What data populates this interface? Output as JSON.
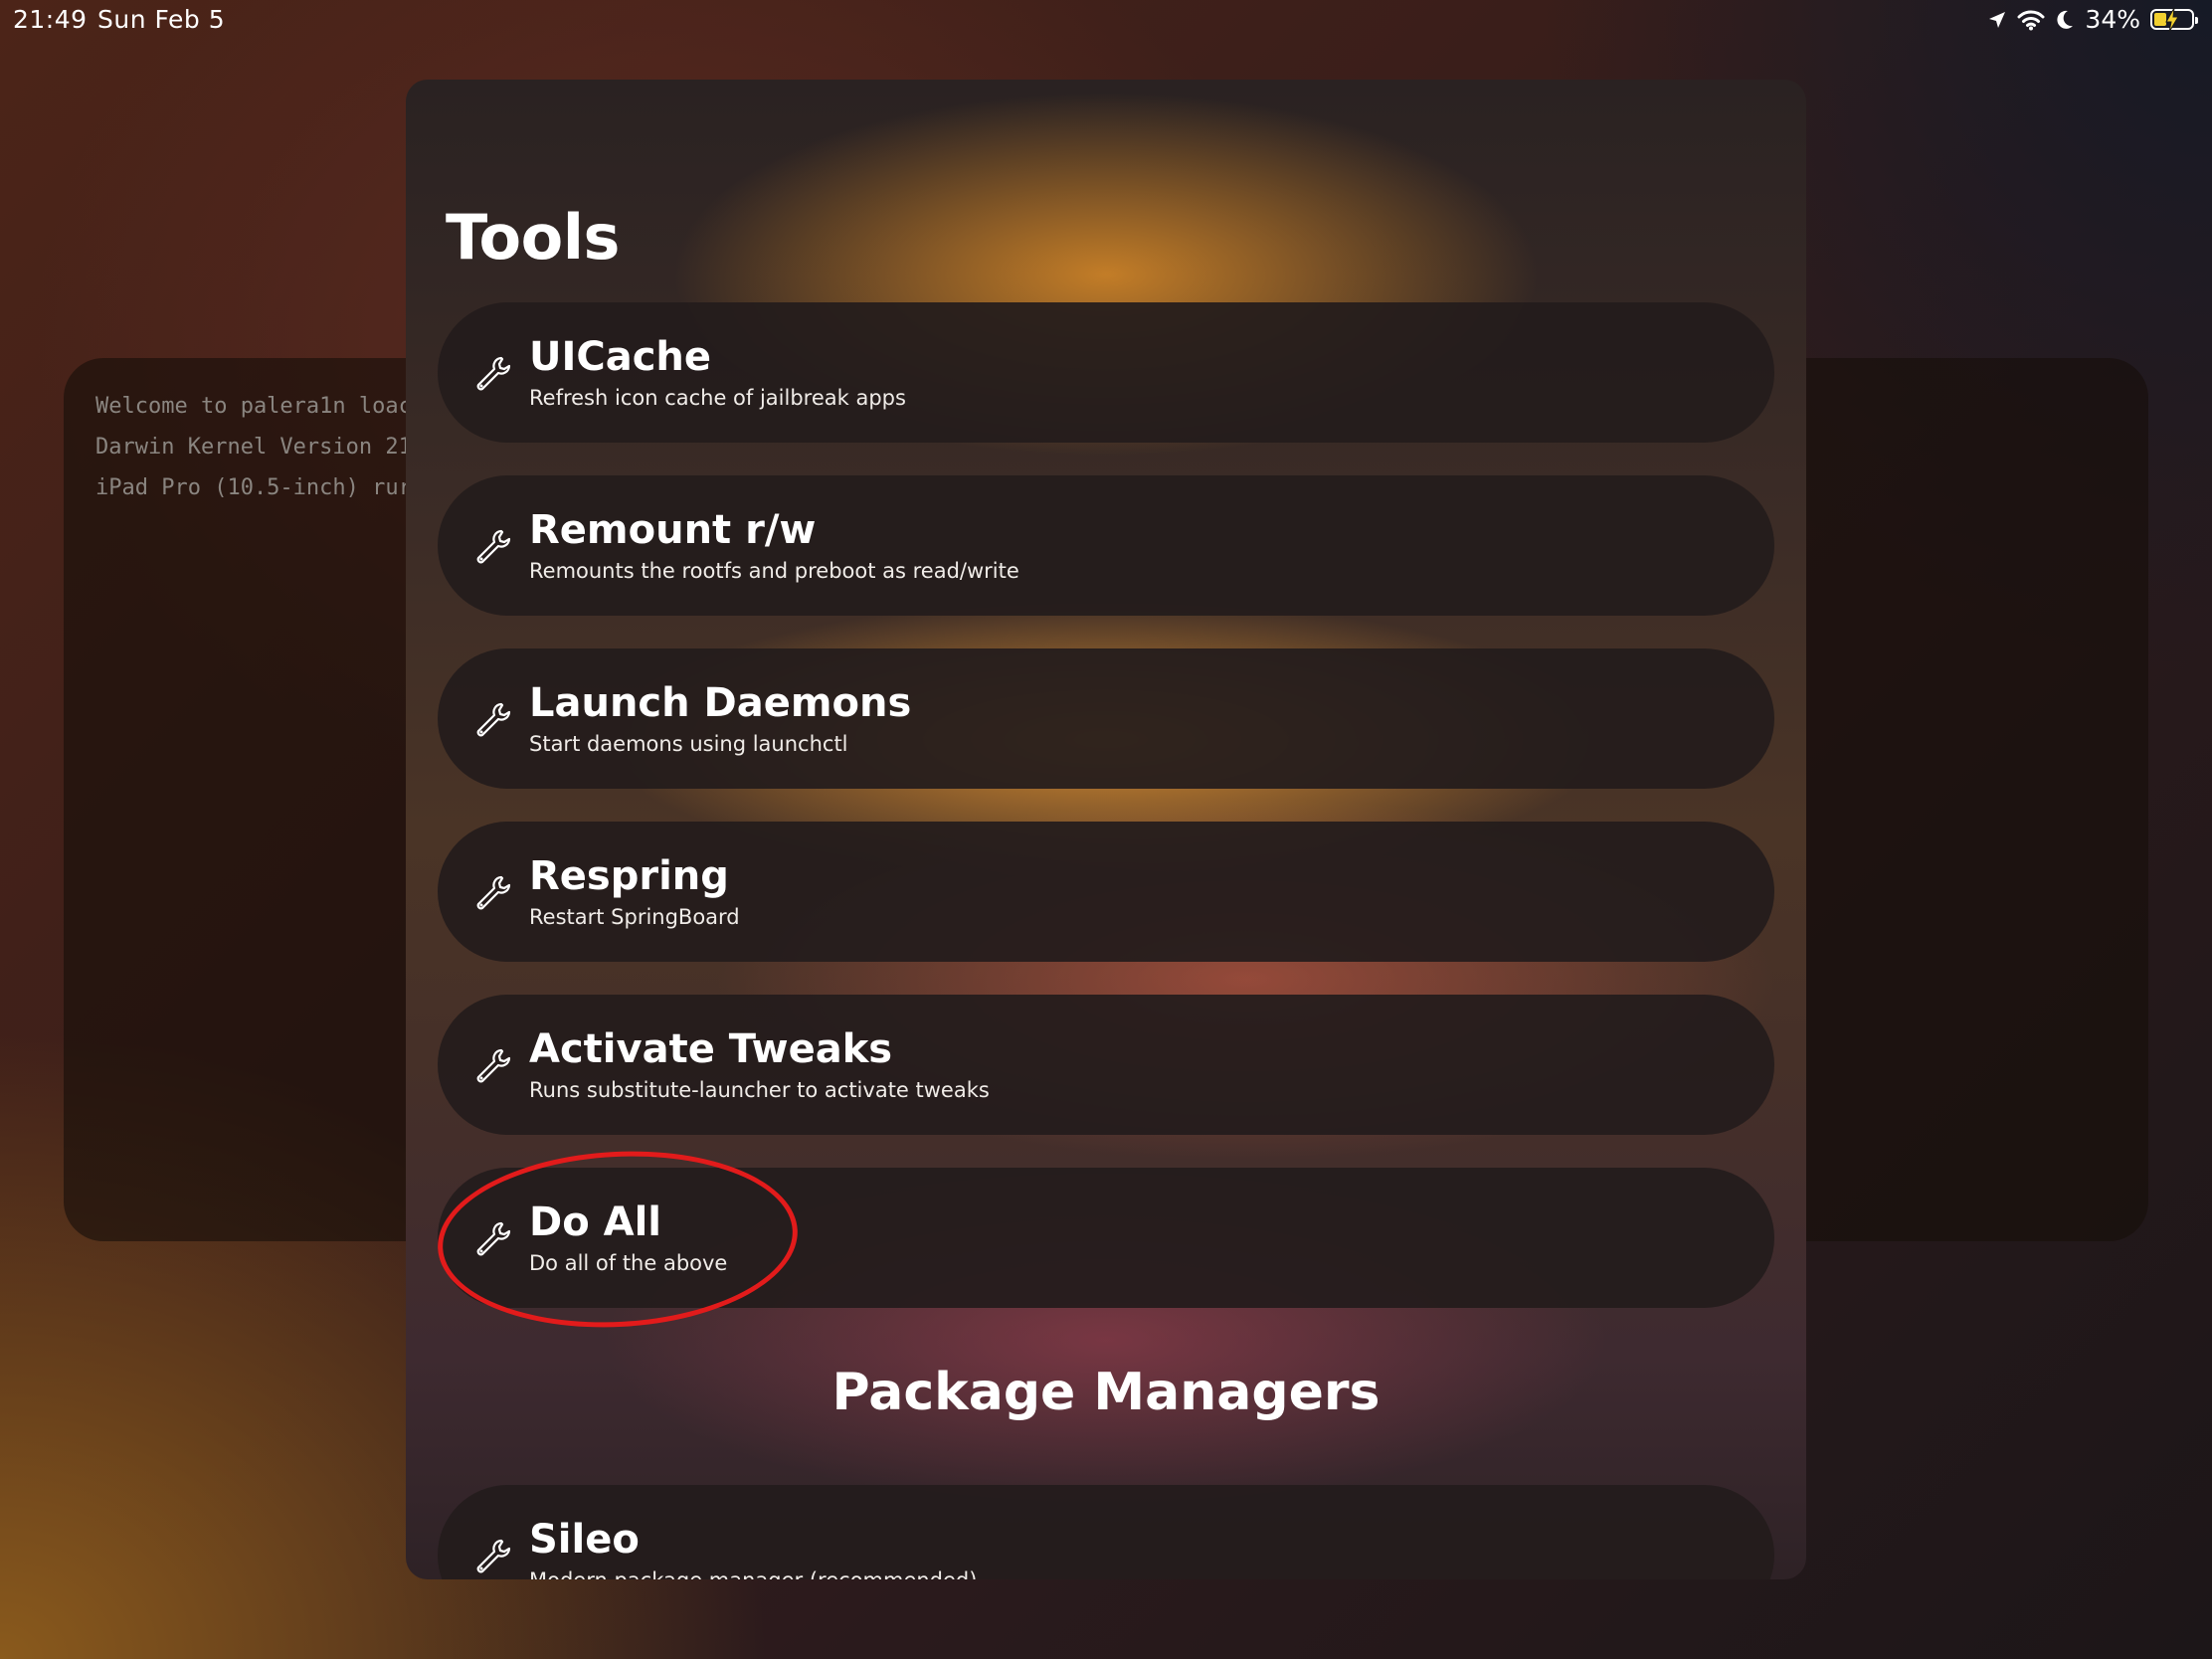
{
  "status_bar": {
    "time": "21:49",
    "date": "Sun Feb 5",
    "battery": "34%",
    "battery_level": 0.34,
    "icons": [
      "location-arrow-icon",
      "wifi-icon",
      "moon-icon",
      "battery-charging-icon"
    ]
  },
  "terminal": {
    "lines": [
      "Welcome to palera1n loac",
      "Darwin Kernel Version 21",
      "iPad Pro (10.5-inch) rur"
    ]
  },
  "tools": {
    "title": "Tools",
    "items": [
      {
        "title": "UICache",
        "description": "Refresh icon cache of jailbreak apps",
        "icon": "wrench-icon"
      },
      {
        "title": "Remount r/w",
        "description": "Remounts the rootfs and preboot as read/write",
        "icon": "wrench-icon"
      },
      {
        "title": "Launch Daemons",
        "description": "Start daemons using launchctl",
        "icon": "wrench-icon"
      },
      {
        "title": "Respring",
        "description": "Restart SpringBoard",
        "icon": "wrench-icon"
      },
      {
        "title": "Activate Tweaks",
        "description": "Runs substitute-launcher to activate tweaks",
        "icon": "wrench-icon"
      },
      {
        "title": "Do All",
        "description": "Do all of the above",
        "icon": "wrench-icon"
      }
    ]
  },
  "package_managers": {
    "title": "Package Managers",
    "items": [
      {
        "title": "Sileo",
        "description": "Modern package manager (recommended)",
        "icon": "wrench-icon"
      }
    ]
  },
  "annotation": {
    "color": "#e21b1b"
  }
}
